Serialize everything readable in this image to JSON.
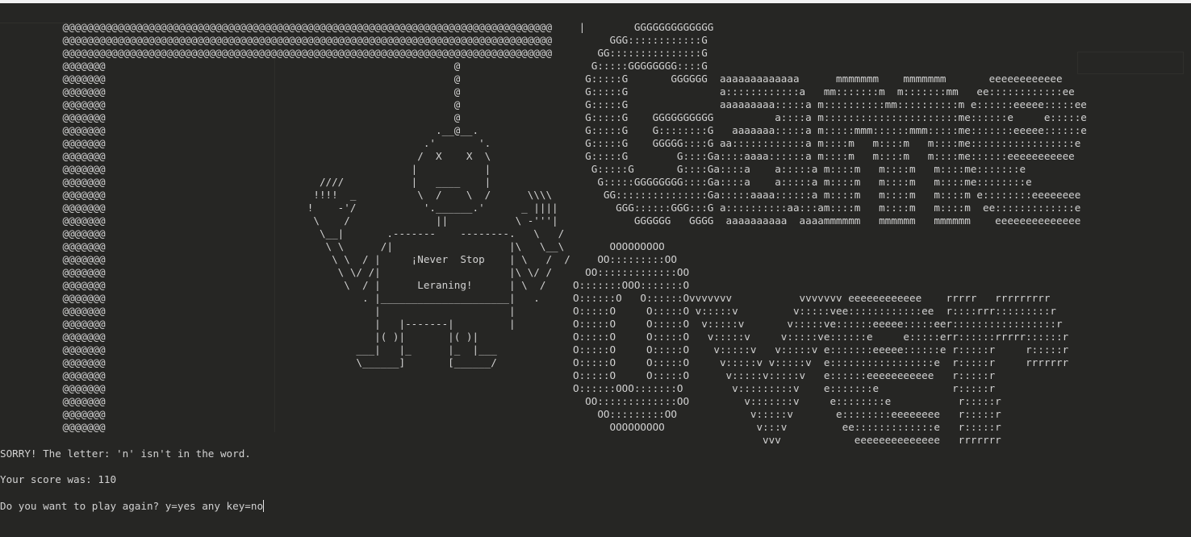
{
  "terminal": {
    "hangman_art": "      @@@@@@@@@@@@@@@@@@@@@@@@@@@@@@@@@@@@@@@@@@@@@@@@@@@@@@@@@@@@@@@@@@@@@@@@@@@@@@@@\n      @@@@@@@@@@@@@@@@@@@@@@@@@@@@@@@@@@@@@@@@@@@@@@@@@@@@@@@@@@@@@@@@@@@@@@@@@@@@@@@@\n      @@@@@@@@@@@@@@@@@@@@@@@@@@@@@@@@@@@@@@@@@@@@@@@@@@@@@@@@@@@@@@@@@@@@@@@@@@@@@@@@\n      @@@@@@@                                                         @\n      @@@@@@@                                                         @\n      @@@@@@@                                                         @\n      @@@@@@@                                                         @\n      @@@@@@@                                                         @\n      @@@@@@@                                                      .__@__.\n      @@@@@@@                                                    .'       '.\n      @@@@@@@                                                   /  X    X  \\\n      @@@@@@@                                                  |           |\n      @@@@@@@                                   ////           |   ____    |\n      @@@@@@@                                  !!!!  _          \\  /    \\  /      \\\\\\\\\n      @@@@@@@                                 !    -'/           '.______.'      _ ||||\n      @@@@@@@                                  \\    /              ||           \\ -'''|\n      @@@@@@@                                   \\__|       .-------    --------.   \\   /\n      @@@@@@@                                    \\ \\      /|                   |\\   \\__\\\n      @@@@@@@                                     \\ \\  / |     ¡Never  Stop    | \\   /  /\n      @@@@@@@                                      \\ \\/ /|                     |\\ \\/ /\n      @@@@@@@                                       \\  / |      Leraning!      | \\  /\n      @@@@@@@                                          . |_____________________|   .\n      @@@@@@@                                            |                     |\n      @@@@@@@                                            |   |-------|         |\n      @@@@@@@                                            |( )|       |( )|\n      @@@@@@@                                         ___|   |_      |_  |___\n      @@@@@@@                                         \\______]       [______/\n      @@@@@@@\n      @@@@@@@\n      @@@@@@@\n      @@@@@@@\n      @@@@@@@",
    "gameover_art": " |        GGGGGGGGGGGGG\n      GGG::::::::::::G\n    GG:::::::::::::::G\n   G:::::GGGGGGGG::::G\n  G:::::G       GGGGGG  aaaaaaaaaaaaa      mmmmmmm    mmmmmmm       eeeeeeeeeeee\n  G:::::G               a::::::::::::a   mm:::::::m  m:::::::mm   ee::::::::::::ee\n  G:::::G               aaaaaaaaa:::::a m::::::::::mm::::::::::m e::::::eeeee:::::ee\n  G:::::G    GGGGGGGGGG          a::::a m::::::::::::::::::::::me::::::e     e:::::e\n  G:::::G    G::::::::G   aaaaaaa:::::a m:::::mmm::::::mmm:::::me:::::::eeeee::::::e\n  G:::::G    GGGGG::::G aa::::::::::::a m::::m   m::::m   m::::me:::::::::::::::::e\n  G:::::G        G::::Ga::::aaaa::::::a m::::m   m::::m   m::::me::::::eeeeeeeeeee\n   G:::::G       G::::Ga::::a    a:::::a m::::m   m::::m   m::::me:::::::e\n    G:::::GGGGGGGG::::Ga::::a    a:::::a m::::m   m::::m   m::::me::::::::e\n     GG:::::::::::::::Ga:::::aaaa::::::a m::::m   m::::m   m::::m e::::::::eeeeeeee\n       GGG::::::GGG:::G a::::::::::aa:::am::::m   m::::m   m::::m  ee:::::::::::::e\n          GGGGGG   GGGG  aaaaaaaaaa  aaaammmmmm   mmmmmm   mmmmmm    eeeeeeeeeeeeee\n\n      OOOOOOOOO\n    OO:::::::::OO\n  OO:::::::::::::OO\nO:::::::OOO:::::::O\nO::::::O   O::::::Ovvvvvvv           vvvvvvv eeeeeeeeeeee    rrrrr   rrrrrrrrr\nO:::::O     O:::::O v:::::v         v:::::vee::::::::::::ee  r::::rrr:::::::::r\nO:::::O     O:::::O  v:::::v       v:::::ve::::::eeeee:::::eer:::::::::::::::::r\nO:::::O     O:::::O   v:::::v     v:::::ve::::::e     e:::::err::::::rrrrr::::::r\nO:::::O     O:::::O    v:::::v   v:::::v e:::::::eeeee::::::e r:::::r     r:::::r\nO:::::O     O:::::O     v:::::v v:::::v  e:::::::::::::::::e  r:::::r     rrrrrrr\nO:::::O     O:::::O      v:::::v:::::v   e::::::eeeeeeeeeee   r:::::r\nO::::::OOO:::::::O        v:::::::::v    e:::::::e            r:::::r\n  OO:::::::::::::OO         v:::::::v     e::::::::e           r:::::r\n    OO:::::::::OO            v:::::v       e::::::::eeeeeeee   r:::::r\n      OOOOOOOOO               v:::v         ee:::::::::::::e   r:::::r\n                               vvv            eeeeeeeeeeeeee   rrrrrrr",
    "message_sorry": "SORRY! The letter: 'n' isn't in the word.",
    "message_score": "Your score was: 110",
    "prompt_play_again": "Do you want to play again? y=yes any key=no"
  }
}
